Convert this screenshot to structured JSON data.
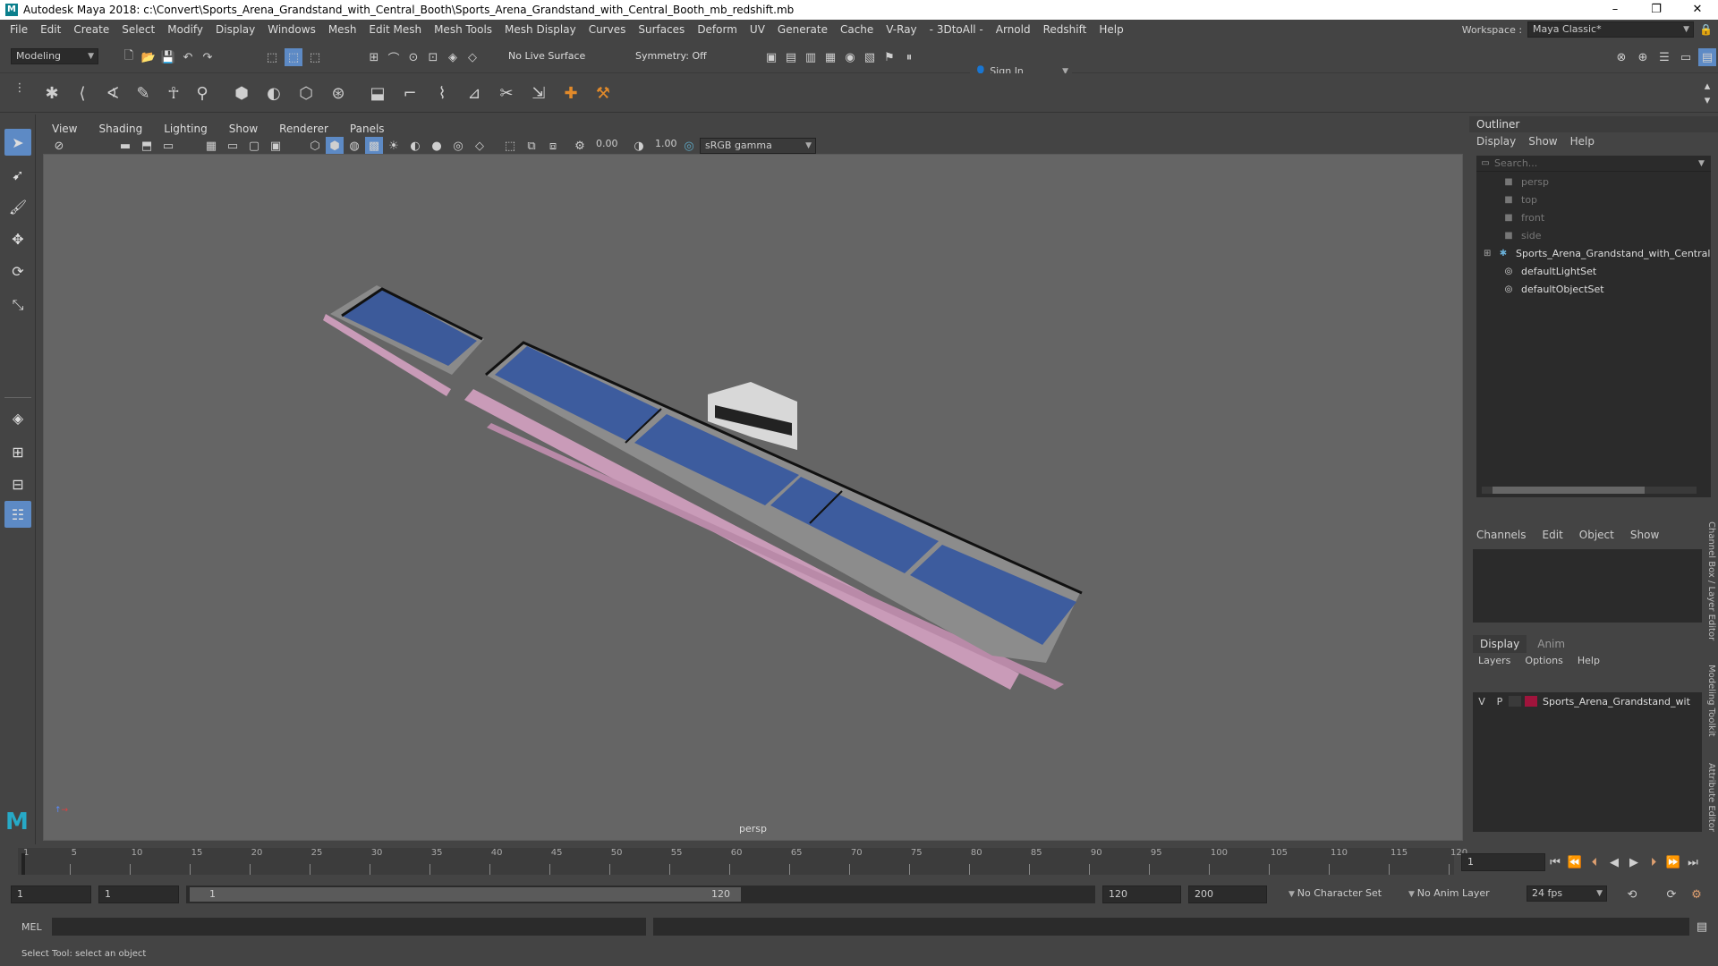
{
  "window": {
    "title": "Autodesk Maya 2018: c:\\Convert\\Sports_Arena_Grandstand_with_Central_Booth\\Sports_Arena_Grandstand_with_Central_Booth_mb_redshift.mb",
    "logo": "M",
    "minimize": "–",
    "restore": "❐",
    "close": "✕"
  },
  "menubar": {
    "items": [
      "File",
      "Edit",
      "Create",
      "Select",
      "Modify",
      "Display",
      "Windows",
      "Mesh",
      "Edit Mesh",
      "Mesh Tools",
      "Mesh Display",
      "Curves",
      "Surfaces",
      "Deform",
      "UV",
      "Generate",
      "Cache",
      "V-Ray",
      "- 3DtoAll -",
      "Arnold",
      "Redshift",
      "Help"
    ],
    "workspace_label": "Workspace :",
    "workspace_value": "Maya Classic*"
  },
  "statusline": {
    "mode": "Modeling",
    "live_surface": "No Live Surface",
    "symmetry": "Symmetry: Off",
    "sign_in": "Sign In"
  },
  "panel": {
    "menus": [
      "View",
      "Shading",
      "Lighting",
      "Show",
      "Renderer",
      "Panels"
    ],
    "exposure": "0.00",
    "gamma": "1.00",
    "colorspace": "sRGB gamma",
    "camera_label": "persp"
  },
  "outliner": {
    "title": "Outliner",
    "menus": [
      "Display",
      "Show",
      "Help"
    ],
    "search_placeholder": "Search...",
    "items": [
      {
        "label": "persp",
        "icon": "camera-icon",
        "dim": true
      },
      {
        "label": "top",
        "icon": "camera-icon",
        "dim": true
      },
      {
        "label": "front",
        "icon": "camera-icon",
        "dim": true
      },
      {
        "label": "side",
        "icon": "camera-icon",
        "dim": true
      },
      {
        "label": "Sports_Arena_Grandstand_with_Central",
        "icon": "group-icon",
        "dim": false
      },
      {
        "label": "defaultLightSet",
        "icon": "set-icon",
        "dim": false
      },
      {
        "label": "defaultObjectSet",
        "icon": "set-icon",
        "dim": false
      }
    ]
  },
  "channelbox": {
    "menus": [
      "Channels",
      "Edit",
      "Object",
      "Show"
    ]
  },
  "layereditor": {
    "tabs": [
      "Display",
      "Anim"
    ],
    "menus": [
      "Layers",
      "Options",
      "Help"
    ],
    "layer": {
      "v": "V",
      "p": "P",
      "name": "Sports_Arena_Grandstand_wit",
      "color": "#a0143c"
    }
  },
  "side_tabs": [
    "Channel Box / Layer Editor",
    "Modeling Toolkit",
    "Attribute Editor"
  ],
  "timeline": {
    "ticks": [
      "1",
      "5",
      "10",
      "15",
      "20",
      "25",
      "30",
      "35",
      "40",
      "45",
      "50",
      "55",
      "60",
      "65",
      "70",
      "75",
      "80",
      "85",
      "90",
      "95",
      "100",
      "105",
      "110",
      "115",
      "120"
    ],
    "current_frame": "1"
  },
  "range": {
    "start": "1",
    "playback_start": "1",
    "slider_start": "1",
    "slider_end": "120",
    "playback_end": "120",
    "end": "200",
    "character_set": "No Character Set",
    "anim_layer": "No Anim Layer",
    "fps": "24 fps"
  },
  "cmdline": {
    "label": "MEL"
  },
  "helpline": {
    "text": "Select Tool: select an object"
  }
}
